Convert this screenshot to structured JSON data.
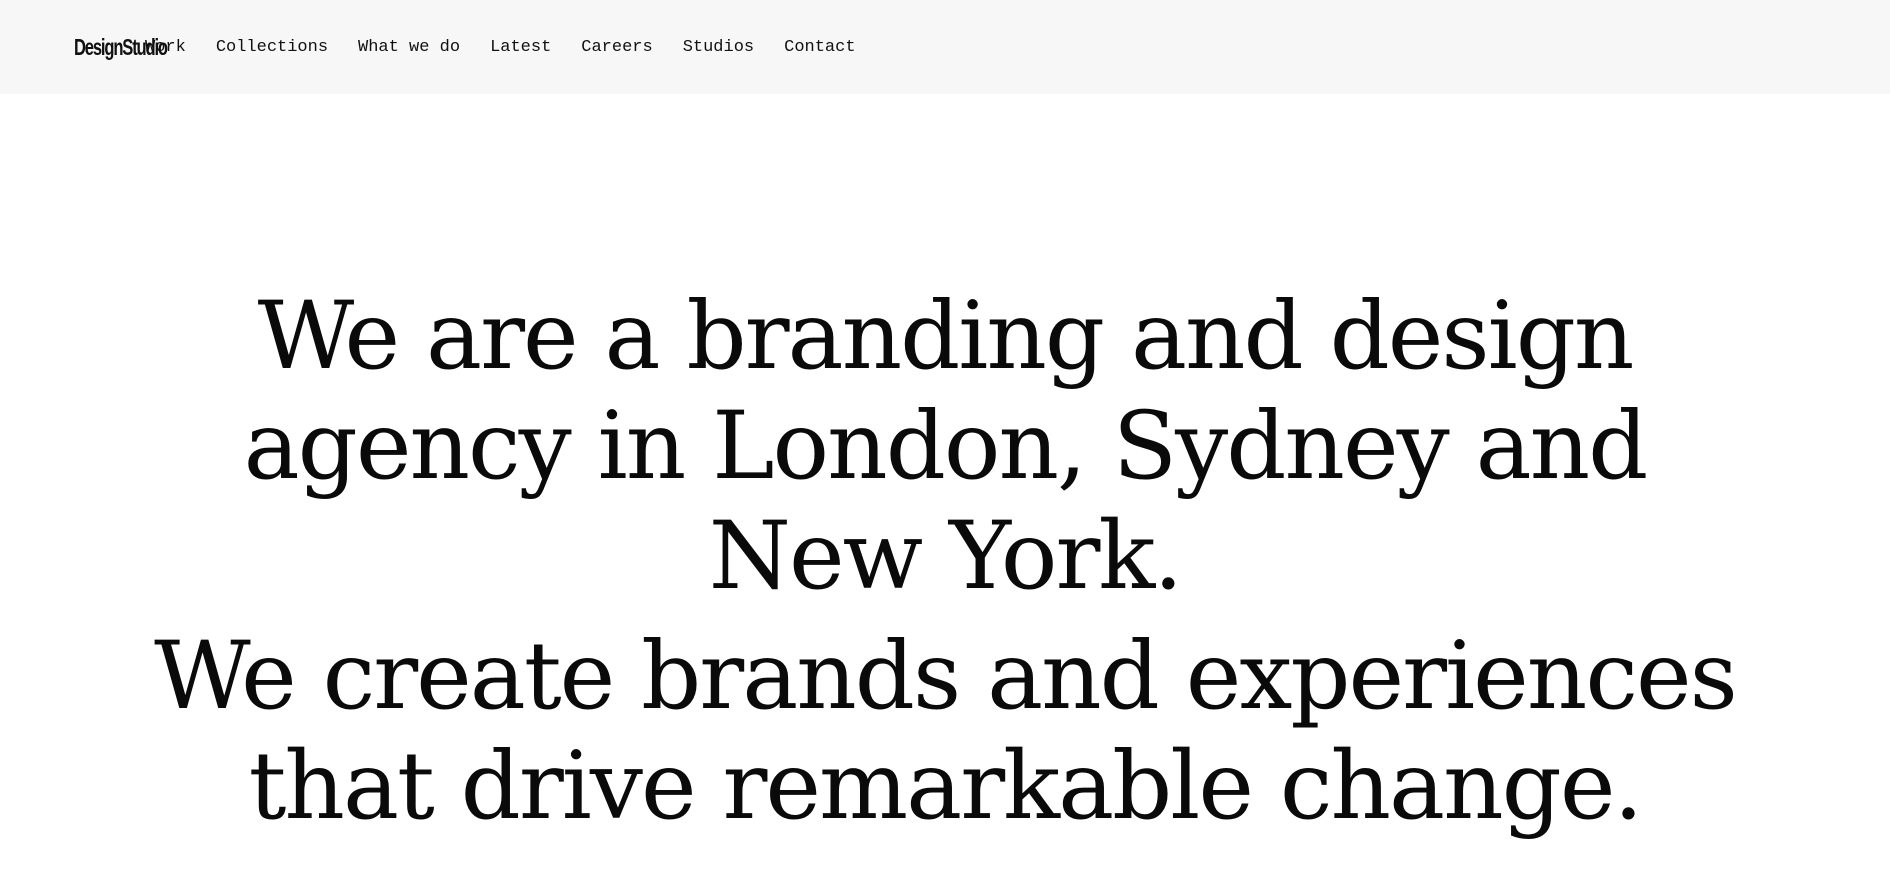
{
  "header": {
    "logo": "DesignStudio",
    "nav": [
      {
        "label": "Work"
      },
      {
        "label": "Collections"
      },
      {
        "label": "What we do"
      },
      {
        "label": "Latest"
      },
      {
        "label": "Careers"
      },
      {
        "label": "Studios"
      },
      {
        "label": "Contact"
      }
    ]
  },
  "hero": {
    "statement_1": [
      "We are a branding and design",
      "agency in London, Sydney and",
      "New York."
    ],
    "statement_2": [
      "We create brands and experiences",
      "that drive remarkable change."
    ]
  },
  "colors": {
    "header_background": "#f7f7f7",
    "page_background": "#ffffff",
    "text": "#0a0a0a"
  }
}
